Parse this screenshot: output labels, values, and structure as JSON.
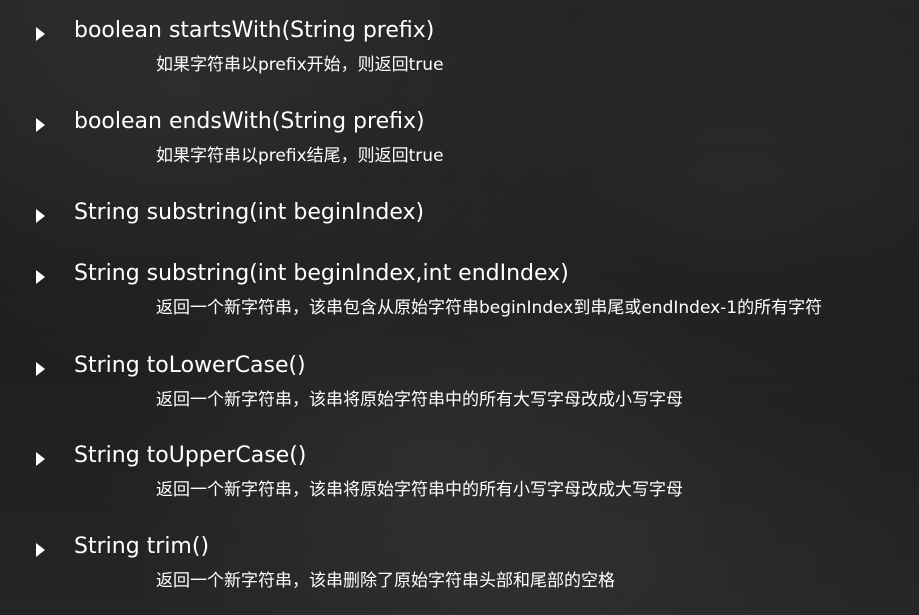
{
  "items": [
    {
      "signature": "boolean startsWith(String prefix)",
      "description": "如果字符串以prefix开始，则返回true"
    },
    {
      "signature": "boolean endsWith(String prefix)",
      "description": "如果字符串以prefix结尾，则返回true"
    },
    {
      "signature": "String substring(int beginIndex)",
      "description": ""
    },
    {
      "signature": "String substring(int beginIndex,int endIndex)",
      "description": "返回一个新字符串，该串包含从原始字符串beginIndex到串尾或endIndex-1的所有字符"
    },
    {
      "signature": "String toLowerCase()",
      "description": "返回一个新字符串，该串将原始字符串中的所有大写字母改成小写字母"
    },
    {
      "signature": "String toUpperCase()",
      "description": "返回一个新字符串，该串将原始字符串中的所有小写字母改成大写字母"
    },
    {
      "signature": "String trim()",
      "description": "返回一个新字符串，该串删除了原始字符串头部和尾部的空格"
    }
  ]
}
